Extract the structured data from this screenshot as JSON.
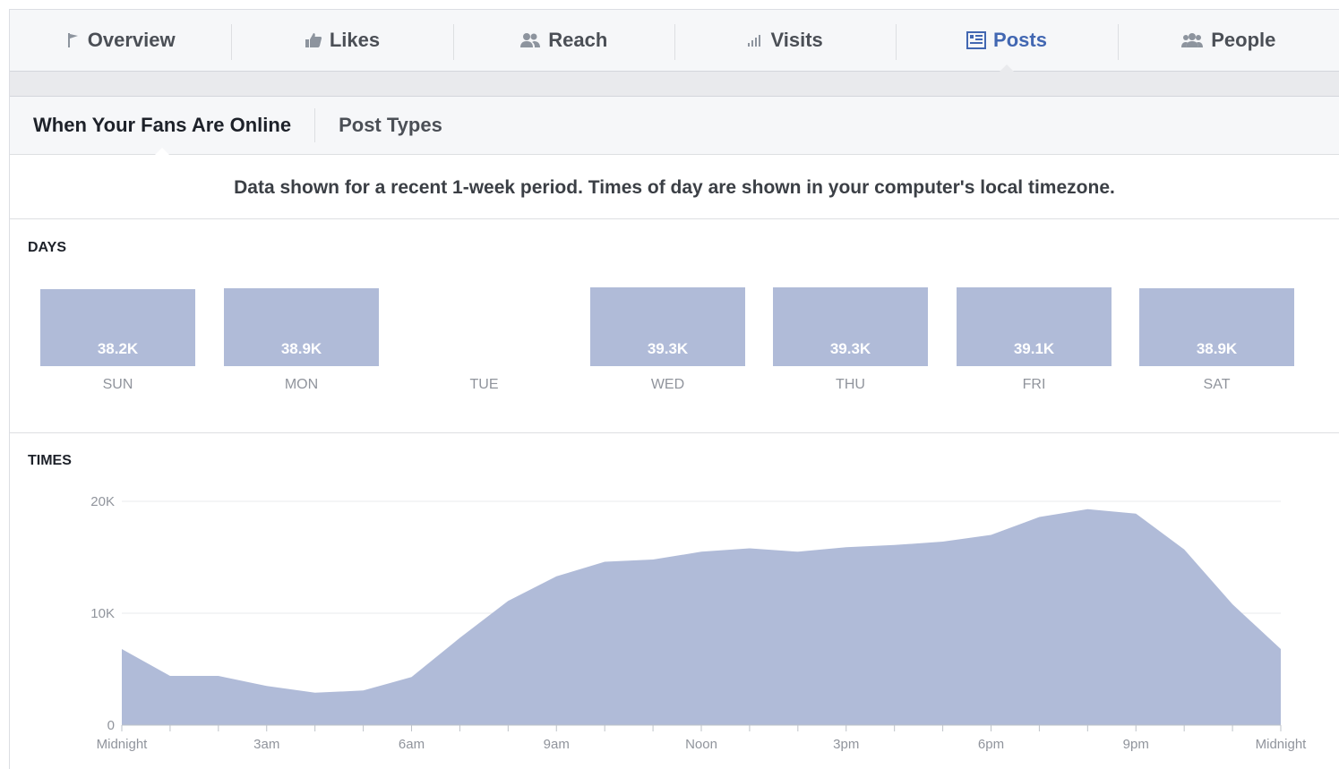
{
  "nav": {
    "tabs": [
      {
        "label": "Overview",
        "icon": "flag-icon",
        "active": false
      },
      {
        "label": "Likes",
        "icon": "thumbs-up-icon",
        "active": false
      },
      {
        "label": "Reach",
        "icon": "people-icon",
        "active": false
      },
      {
        "label": "Visits",
        "icon": "bar-signal-icon",
        "active": false
      },
      {
        "label": "Posts",
        "icon": "posts-icon",
        "active": true
      },
      {
        "label": "People",
        "icon": "group-icon",
        "active": false
      }
    ],
    "accent": "#4267b2"
  },
  "subnav": {
    "tabs": [
      {
        "label": "When Your Fans Are Online",
        "active": true
      },
      {
        "label": "Post Types",
        "active": false
      }
    ]
  },
  "notice": "Data shown for a recent 1-week period. Times of day are shown in your computer's local timezone.",
  "days_title": "DAYS",
  "times_title": "TIMES",
  "chart_data": [
    {
      "type": "bar",
      "title": "DAYS",
      "categories": [
        "SUN",
        "MON",
        "TUE",
        "WED",
        "THU",
        "FRI",
        "SAT"
      ],
      "values": [
        38200,
        38900,
        null,
        39300,
        39300,
        39100,
        38900
      ],
      "value_labels": [
        "38.2K",
        "38.9K",
        "",
        "39.3K",
        "39.3K",
        "39.1K",
        "38.9K"
      ],
      "color": "#b0bbd8"
    },
    {
      "type": "area",
      "title": "TIMES",
      "x_tick_labels": [
        "Midnight",
        "3am",
        "6am",
        "9am",
        "Noon",
        "3pm",
        "6pm",
        "9pm",
        "Midnight"
      ],
      "x": [
        0,
        1,
        2,
        3,
        4,
        5,
        6,
        7,
        8,
        9,
        10,
        11,
        12,
        13,
        14,
        15,
        16,
        17,
        18,
        19,
        20,
        21,
        22,
        23,
        24
      ],
      "values": [
        6800,
        4400,
        4400,
        3500,
        2900,
        3100,
        4300,
        7800,
        11100,
        13300,
        14600,
        14800,
        15500,
        15800,
        15500,
        15900,
        16100,
        16400,
        17000,
        18600,
        19300,
        18900,
        15700,
        10800,
        6800
      ],
      "y_ticks": [
        0,
        10000,
        20000
      ],
      "y_tick_labels": [
        "0",
        "10K",
        "20K"
      ],
      "ylim": [
        0,
        20000
      ],
      "grid": true,
      "color": "#b0bbd8"
    }
  ]
}
